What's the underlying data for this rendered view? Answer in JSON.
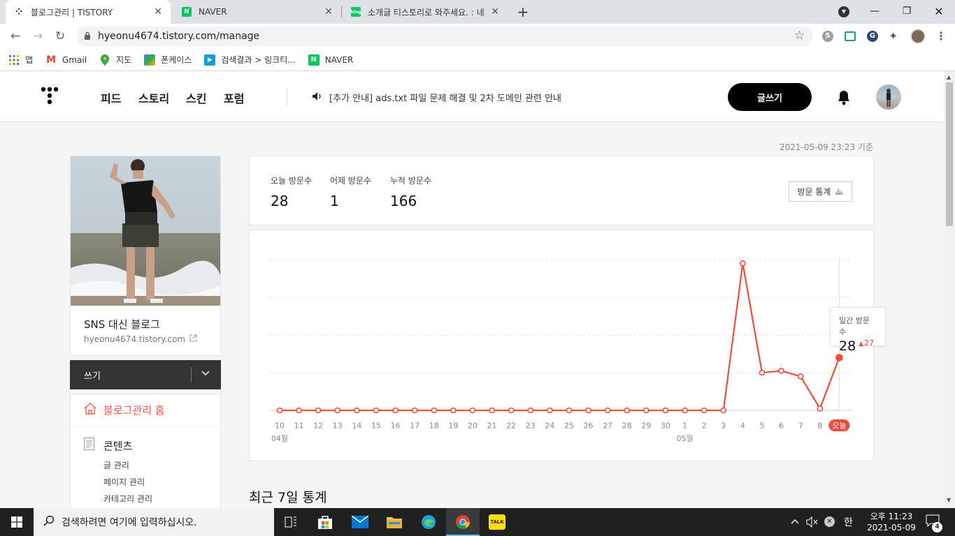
{
  "browser": {
    "tabs": [
      {
        "title": "블로그관리 | TISTORY",
        "active": true,
        "favicon": "tistory-icon"
      },
      {
        "title": "NAVER",
        "active": false,
        "favicon": "naver-icon"
      },
      {
        "title": "소개글 티스토리로 와주세요. : 네",
        "active": false,
        "favicon": "blog-icon"
      }
    ],
    "url": "hyeonu4674.tistory.com/manage",
    "bookmarks": [
      {
        "label": "앱",
        "icon": "apps-grid-icon"
      },
      {
        "label": "Gmail",
        "icon": "gmail-icon"
      },
      {
        "label": "지도",
        "icon": "maps-icon"
      },
      {
        "label": "폰케이스",
        "icon": "bookmark-icon"
      },
      {
        "label": "검색결과 > 링크티...",
        "icon": "play-icon"
      },
      {
        "label": "NAVER",
        "icon": "naver-icon"
      }
    ]
  },
  "header": {
    "nav": [
      "피드",
      "스토리",
      "스킨",
      "포럼"
    ],
    "notice": "[추가 안내] ads.txt 파일 문제 해결 및 2차 도메인 관련 안내",
    "write_label": "글쓰기"
  },
  "profile": {
    "blog_name": "SNS 대신 블로그",
    "blog_url": "hyeonu4674.tistory.com",
    "write_button": "쓰기"
  },
  "menu": {
    "home": "블로그관리 홈",
    "contents_title": "콘텐츠",
    "items": [
      "글 관리",
      "페이지 관리",
      "카테고리 관리"
    ]
  },
  "stats": {
    "timestamp": "2021-05-09 23:23 기준",
    "today_label": "오늘 방문수",
    "today_value": "28",
    "yesterday_label": "어제 방문수",
    "yesterday_value": "1",
    "total_label": "누적 방문수",
    "total_value": "166",
    "stats_button": "방문 통계"
  },
  "tooltip": {
    "label": "일간 방문수",
    "value": "28",
    "delta": "27"
  },
  "section_title": "최근 7일 통계",
  "chart_data": {
    "type": "line",
    "x": [
      "10",
      "11",
      "12",
      "13",
      "14",
      "15",
      "16",
      "17",
      "18",
      "19",
      "20",
      "21",
      "22",
      "23",
      "24",
      "25",
      "26",
      "27",
      "28",
      "29",
      "30",
      "1",
      "2",
      "3",
      "4",
      "5",
      "6",
      "7",
      "8",
      "오늘"
    ],
    "month_labels": [
      {
        "index": 0,
        "label": "04월"
      },
      {
        "index": 21,
        "label": "05월"
      }
    ],
    "series": [
      {
        "values": [
          0,
          0,
          0,
          0,
          0,
          0,
          0,
          0,
          0,
          0,
          0,
          0,
          0,
          0,
          0,
          0,
          0,
          0,
          0,
          0,
          0,
          0,
          0,
          0,
          78,
          20,
          21,
          18,
          1,
          28
        ]
      }
    ],
    "ylim": [
      0,
      80
    ],
    "grid": true,
    "color": "#f04c3c"
  },
  "taskbar": {
    "search_placeholder": "검색하려면 여기에 입력하십시오.",
    "time": "오후 11:23",
    "date": "2021-05-09",
    "ime": "한",
    "notifications": "4"
  }
}
